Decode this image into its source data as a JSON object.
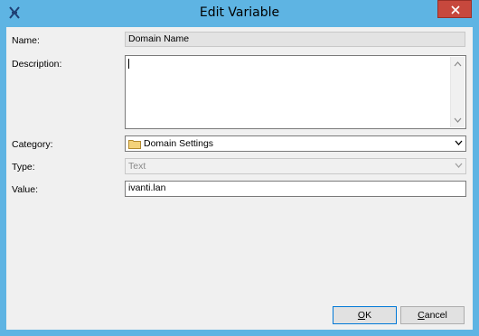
{
  "window": {
    "title": "Edit Variable"
  },
  "form": {
    "name_label": "Name:",
    "name_value": "Domain Name",
    "description_label": "Description:",
    "description_value": "",
    "category_label": "Category:",
    "category_value": "Domain Settings",
    "type_label": "Type:",
    "type_value": "Text",
    "value_label": "Value:",
    "value_value": "ivanti.lan"
  },
  "buttons": {
    "ok_mnemonic": "O",
    "ok_rest": "K",
    "cancel_mnemonic": "C",
    "cancel_rest": "ancel"
  },
  "icons": {
    "app": "app-logo-icon",
    "close": "close-icon",
    "folder": "folder-icon",
    "dropdown": "chevron-down-icon",
    "scroll_up": "chevron-up-icon",
    "scroll_down": "chevron-down-icon"
  },
  "colors": {
    "titlebar": "#5eb4e3",
    "close": "#c7483d",
    "default_button_border": "#0078d7"
  }
}
